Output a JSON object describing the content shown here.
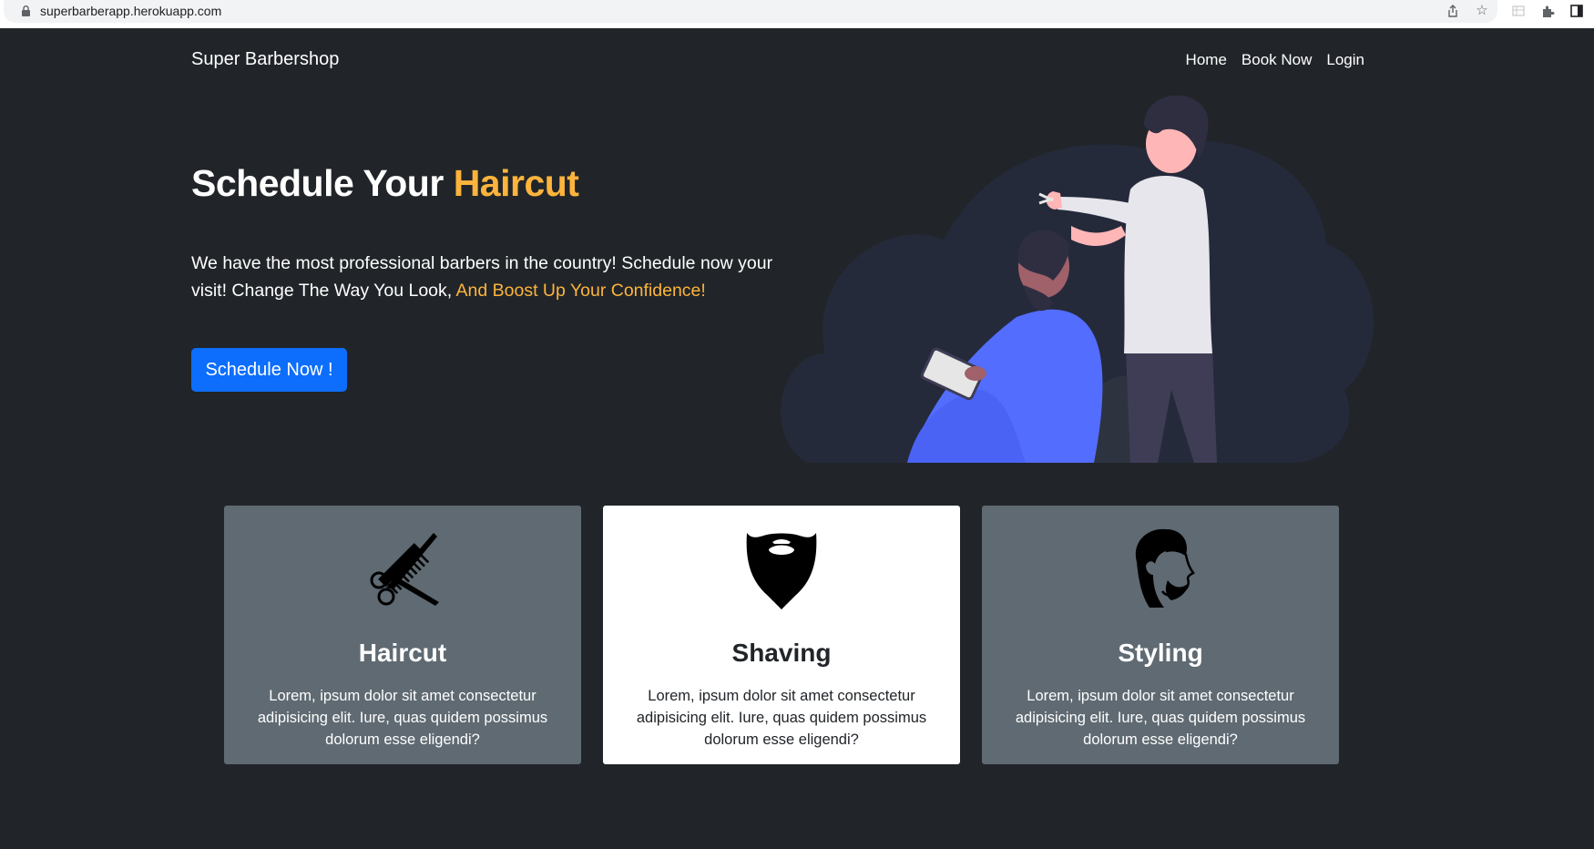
{
  "browser": {
    "url": "superbarberapp.herokuapp.com"
  },
  "navbar": {
    "brand": "Super Barbershop",
    "links": [
      "Home",
      "Book Now",
      "Login"
    ]
  },
  "hero": {
    "title_plain": "Schedule Your",
    "title_accent": "Haircut",
    "text_plain": "We have the most professional barbers in the country! Schedule now your visit! Change The Way You Look,",
    "text_accent": "And Boost Up Your Confidence!",
    "cta_label": "Schedule Now !"
  },
  "colors": {
    "background": "#212529",
    "accent": "#fdb43d",
    "primary_button": "#0d6efd",
    "card_grey": "#5f6a72"
  },
  "services": [
    {
      "title": "Haircut",
      "icon": "comb-scissors-icon",
      "description": "Lorem, ipsum dolor sit amet consectetur adipisicing elit. Iure, quas quidem possimus dolorum esse eligendi?"
    },
    {
      "title": "Shaving",
      "icon": "beard-icon",
      "description": "Lorem, ipsum dolor sit amet consectetur adipisicing elit. Iure, quas quidem possimus dolorum esse eligendi?"
    },
    {
      "title": "Styling",
      "icon": "man-profile-icon",
      "description": "Lorem, ipsum dolor sit amet consectetur adipisicing elit. Iure, quas quidem possimus dolorum esse eligendi?"
    }
  ]
}
